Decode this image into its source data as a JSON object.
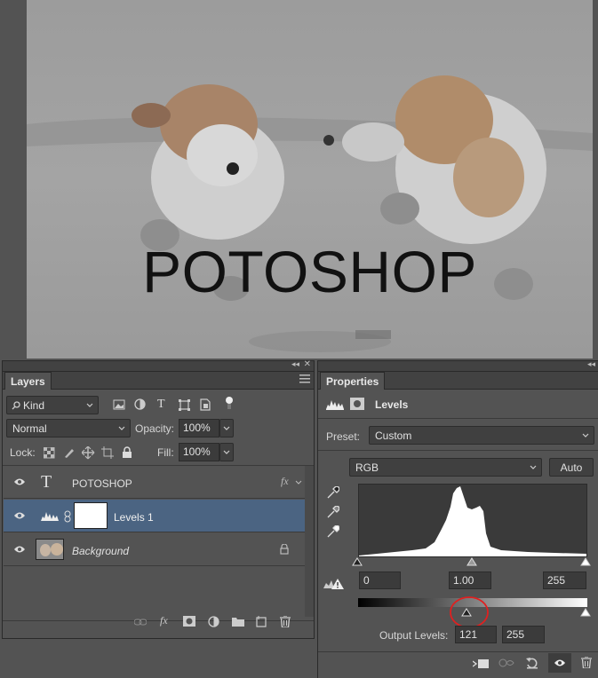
{
  "canvas": {
    "text": "POTOSHOP"
  },
  "layers_panel": {
    "tab_label": "Layers",
    "kind_label": "Kind",
    "blend_mode": "Normal",
    "opacity_label": "Opacity:",
    "opacity_value": "100%",
    "lock_label": "Lock:",
    "fill_label": "Fill:",
    "fill_value": "100%",
    "layers": [
      {
        "name": "POTOSHOP",
        "type": "text"
      },
      {
        "name": "Levels 1",
        "type": "adjustment"
      },
      {
        "name": "Background",
        "type": "image"
      }
    ]
  },
  "properties_panel": {
    "tab_label": "Properties",
    "title": "Levels",
    "preset_label": "Preset:",
    "preset_value": "Custom",
    "channel": "RGB",
    "auto_label": "Auto",
    "input_black": "0",
    "input_gamma": "1.00",
    "input_white": "255",
    "output_label": "Output Levels:",
    "output_black": "121",
    "output_white": "255"
  }
}
